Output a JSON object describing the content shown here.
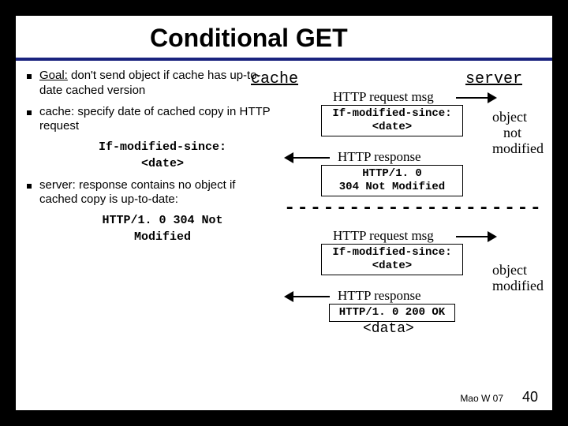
{
  "title": "Conditional GET",
  "cache_label": "cache",
  "server_label": "server",
  "bullets": {
    "b1_goal": "Goal:",
    "b1_rest": " don't send object if cache has up-to-date cached version",
    "b2": "cache: specify date of cached copy in HTTP request",
    "b2_code_l1": "If-modified-since:",
    "b2_code_l2": "<date>",
    "b3": "server: response contains no object if cached copy is up-to-date:",
    "b3_code_l1": "HTTP/1. 0 304 Not",
    "b3_code_l2": "Modified"
  },
  "diagram": {
    "req1_arrow_label": "HTTP request msg",
    "req1_box_l1": "If-modified-since:",
    "req1_box_l2": "<date>",
    "resp1_arrow_label": "HTTP response",
    "resp1_box_l1": "HTTP/1. 0",
    "resp1_box_l2": "304 Not Modified",
    "annot1_l1": "object",
    "annot1_l2": "not",
    "annot1_l3": "modified",
    "req2_arrow_label": "HTTP request msg",
    "req2_box_l1": "If-modified-since:",
    "req2_box_l2": "<date>",
    "resp2_arrow_label": "HTTP response",
    "resp2_box_l1": "HTTP/1. 0 200 OK",
    "annot2_l1": "object",
    "annot2_l2": "modified",
    "data_label": "<data>"
  },
  "footer": {
    "left": "Mao W 07",
    "num": "40"
  }
}
